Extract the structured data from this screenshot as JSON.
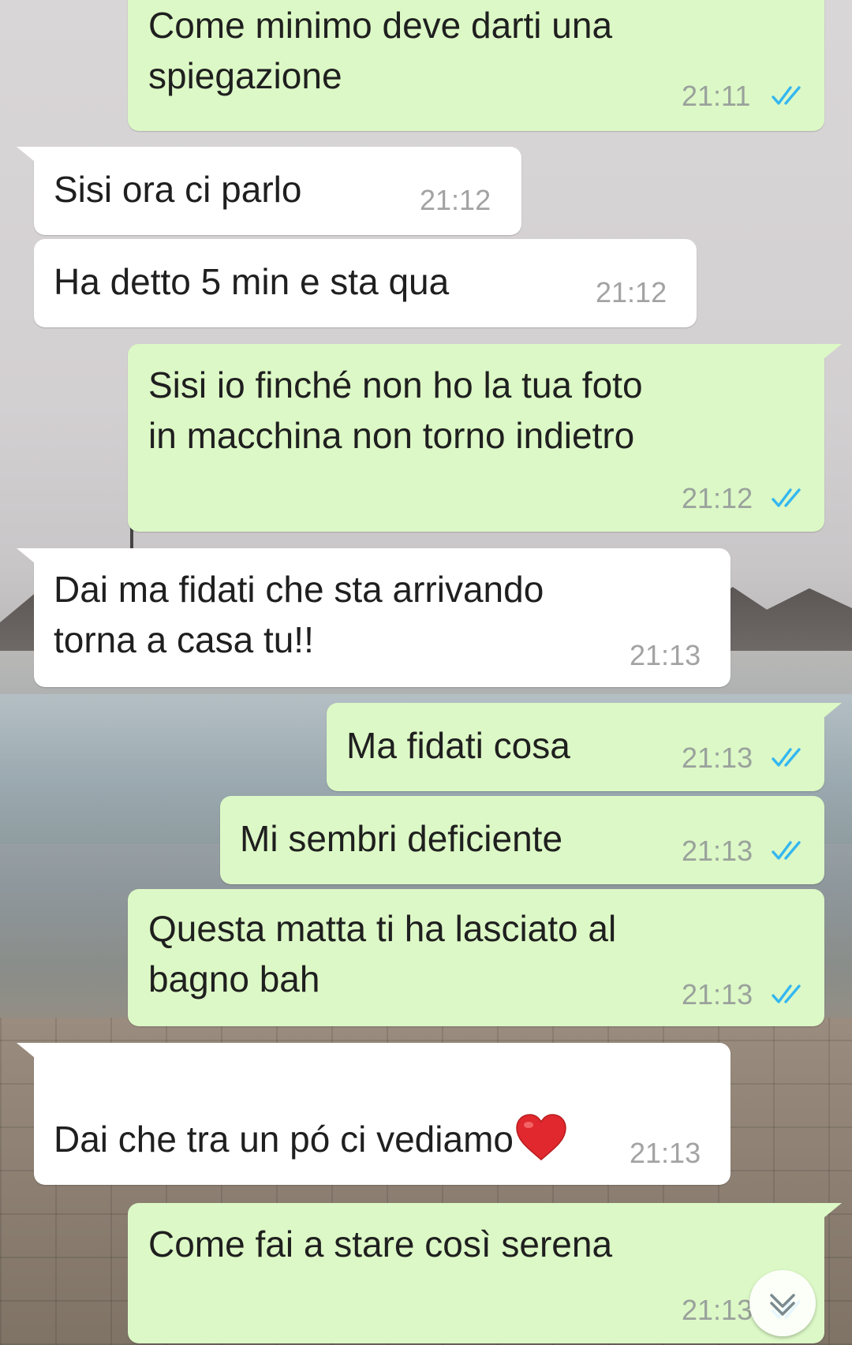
{
  "chat": {
    "messages": [
      {
        "dir": "out",
        "text": "Come minimo deve darti una\nspiegazione",
        "time": "21:11",
        "status": "read"
      },
      {
        "dir": "in",
        "text": "Sisi ora ci parlo",
        "time": "21:12"
      },
      {
        "dir": "in",
        "text": "Ha detto 5 min e sta qua",
        "time": "21:12"
      },
      {
        "dir": "out",
        "text": "Sisi io finché non ho la tua foto\nin macchina non torno indietro",
        "time": "21:12",
        "status": "read"
      },
      {
        "dir": "in",
        "text": "Dai ma fidati che sta arrivando\ntorna a casa tu!!",
        "time": "21:13"
      },
      {
        "dir": "out",
        "text": "Ma fidati cosa",
        "time": "21:13",
        "status": "read"
      },
      {
        "dir": "out",
        "text": "Mi sembri deficiente",
        "time": "21:13",
        "status": "read"
      },
      {
        "dir": "out",
        "text": "Questa matta ti ha lasciato al\nbagno bah",
        "time": "21:13",
        "status": "read"
      },
      {
        "dir": "in",
        "text": "Dai che tra un pó ci vediamo",
        "emoji": "red-heart",
        "time": "21:13"
      },
      {
        "dir": "out",
        "text": "Come fai a stare così serena",
        "time": "21:13",
        "status": "read"
      }
    ]
  },
  "icons": {
    "read_ticks": "double-check-icon",
    "scroll_down": "chevron-down-icon",
    "heart": "red-heart-emoji"
  },
  "colors": {
    "outgoing_bubble": "#dcf8c6",
    "incoming_bubble": "#ffffff",
    "read_ticks": "#34b7f1",
    "timestamp": "#9aa29c",
    "heart": "#e0282e"
  }
}
